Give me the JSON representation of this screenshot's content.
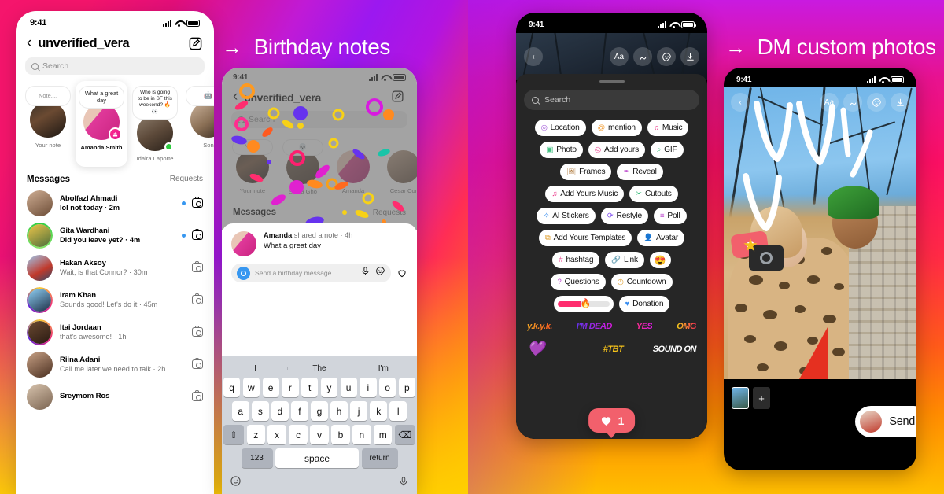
{
  "background": {
    "left_gradient": [
      "#f5156c",
      "#c01ad6",
      "#9b18f0",
      "#ff2d55",
      "#ffaa00"
    ],
    "right_gradient": [
      "#c91ae0",
      "#fa0f63",
      "#ff5a1a",
      "#ffbe00"
    ]
  },
  "headlines": {
    "birthday": {
      "arrow": "→",
      "text": "Birthday notes"
    },
    "dm_photos": {
      "arrow": "→",
      "text": "DM custom photos"
    }
  },
  "phone1": {
    "status": {
      "time": "9:41"
    },
    "header": {
      "back": "‹",
      "title": "unverified_vera",
      "compose_icon": "compose-icon"
    },
    "search": {
      "placeholder": "Search",
      "icon": "search-icon"
    },
    "notes": [
      {
        "bubble": "Note....",
        "name": "Your note",
        "badge": "",
        "placeholder": true
      },
      {
        "bubble": "What a great day",
        "name": "Amanda Smith",
        "badge": "birthday-cake-icon",
        "active": true
      },
      {
        "bubble": "Who is going to be in SF this weekend? 🔥👀",
        "name": "Idaira Laporte",
        "badge": "online-dot"
      },
      {
        "bubble": "🤖",
        "name": "Son",
        "badge": ""
      }
    ],
    "messages_header": {
      "title": "Messages",
      "requests": "Requests"
    },
    "messages": [
      {
        "name": "Abolfazl Ahmadi",
        "preview": "lol not today · 2m",
        "unread": true,
        "ring": false
      },
      {
        "name": "Gita Wardhani",
        "preview": "Did you leave yet? · 4m",
        "unread": true,
        "ring": "green"
      },
      {
        "name": "Hakan Aksoy",
        "preview": "Wait, is that Connor? · 30m",
        "unread": false,
        "ring": false
      },
      {
        "name": "Iram Khan",
        "preview": "Sounds good! Let's do it · 45m",
        "unread": false,
        "ring": "story"
      },
      {
        "name": "Itai Jordaan",
        "preview": "that's awesome! · 1h",
        "unread": false,
        "ring": "story"
      },
      {
        "name": "Riina Adani",
        "preview": "Call me later we need to talk · 2h",
        "unread": false,
        "ring": false
      },
      {
        "name": "Sreymom Ros",
        "preview": "",
        "unread": false,
        "ring": false
      }
    ]
  },
  "phone2": {
    "status": {
      "time": "9:41"
    },
    "header": {
      "back": "‹",
      "title": "unverified_vera",
      "compose_icon": "compose-icon"
    },
    "search": {
      "placeholder": "Search",
      "icon": "search-icon"
    },
    "notes": [
      {
        "bubble": "Note...",
        "name": "Your note"
      },
      {
        "bubble": "💀",
        "name": "Sonia Gho"
      },
      {
        "bubble": "",
        "name": "Amanda"
      },
      {
        "bubble": "",
        "name": "Cesar Cor"
      }
    ],
    "messages_header": {
      "title": "Messages",
      "requests": "Requests"
    },
    "note_card": {
      "author": "Amanda",
      "meta": " shared a note · 4h",
      "body": "What a great day"
    },
    "reply": {
      "placeholder": "Send a birthday message",
      "mic_icon": "microphone-icon",
      "sticker_icon": "sticker-icon",
      "heart_icon": "heart-icon"
    },
    "keyboard": {
      "suggestions": [
        "I",
        "The",
        "I'm"
      ],
      "row1": [
        "q",
        "w",
        "e",
        "r",
        "t",
        "y",
        "u",
        "i",
        "o",
        "p"
      ],
      "row2": [
        "a",
        "s",
        "d",
        "f",
        "g",
        "h",
        "j",
        "k",
        "l"
      ],
      "row3": [
        "z",
        "x",
        "c",
        "v",
        "b",
        "n",
        "m"
      ],
      "shift": "⇧",
      "backspace": "⌫",
      "num": "123",
      "space": "space",
      "return": "return",
      "emoji": "☺",
      "dictate": "microphone-icon"
    }
  },
  "phone3": {
    "status": {
      "time": "9:41"
    },
    "story_controls": {
      "back": "‹",
      "text_tool": "Aa",
      "draw_tool": "draw-icon",
      "sticker_tool": "sticker-icon",
      "download_tool": "download-icon"
    },
    "search": {
      "placeholder": "Search",
      "icon": "search-icon"
    },
    "chips": [
      [
        {
          "label": "Location",
          "icon": "◎",
          "color": "#a259d9"
        },
        {
          "label": "mention",
          "icon": "@",
          "color": "#f29b30"
        },
        {
          "label": "Music",
          "icon": "♫",
          "color": "#ec3f8e"
        }
      ],
      [
        {
          "label": "Photo",
          "icon": "▣",
          "color": "#3fbf7f"
        },
        {
          "label": "Add yours",
          "icon": "◎",
          "color": "#ec3f8e"
        },
        {
          "label": "GIF",
          "icon": "⌕",
          "color": "#3fbf7f"
        }
      ],
      [
        {
          "label": "Frames",
          "icon": "🖼",
          "color": "#b07a3c"
        },
        {
          "label": "Reveal",
          "icon": "✒",
          "color": "#c050d0"
        }
      ],
      [
        {
          "label": "Add Yours Music",
          "icon": "♫",
          "color": "#ec3f8e"
        },
        {
          "label": "Cutouts",
          "icon": "✂",
          "color": "#3fbf7f"
        }
      ],
      [
        {
          "label": "AI Stickers",
          "icon": "✧",
          "color": "#3a8ef0"
        },
        {
          "label": "Restyle",
          "icon": "⟳",
          "color": "#8a5cf0"
        },
        {
          "label": "Poll",
          "icon": "≡",
          "color": "#c050d0"
        }
      ],
      [
        {
          "label": "Add Yours Templates",
          "icon": "⧉",
          "color": "#e0a030"
        },
        {
          "label": "Avatar",
          "icon": "👤",
          "color": "#d05030"
        }
      ],
      [
        {
          "label": "hashtag",
          "icon": "#",
          "color": "#ec3f8e"
        },
        {
          "label": "Link",
          "icon": "🔗",
          "color": "#3a8ef0"
        },
        {
          "label": "😍",
          "icon": "",
          "color": ""
        }
      ],
      [
        {
          "label": "Questions",
          "icon": "?",
          "color": "#c050d0"
        },
        {
          "label": "Countdown",
          "icon": "◴",
          "color": "#e0a030"
        }
      ],
      [
        {
          "label": "slider",
          "icon": "🔥",
          "color": "#ff2d6f"
        },
        {
          "label": "Donation",
          "icon": "♥",
          "color": "#3a8ef0"
        }
      ]
    ],
    "stickers_row1": [
      "y.k.y.k.",
      "I'M DEAD",
      "YES",
      "OMG"
    ],
    "stickers_row2": [
      "💜",
      "",
      "#TBT",
      "SOUND ON"
    ],
    "like_popup": {
      "icon": "heart-icon",
      "count": "1"
    }
  },
  "phone4": {
    "status": {
      "time": "9:41"
    },
    "controls": {
      "back": "‹",
      "text_tool": "Aa",
      "draw_tool": "draw-icon",
      "sticker_tool": "sticker-icon",
      "download_tool": "download-icon"
    },
    "overlays": {
      "like_sticker": "like-heart-sticker",
      "camera_sticker": "camera-flash-sticker"
    },
    "thumbs": {
      "add": "+"
    },
    "send": {
      "label": "Send",
      "avatar": "recipient-avatar"
    }
  }
}
